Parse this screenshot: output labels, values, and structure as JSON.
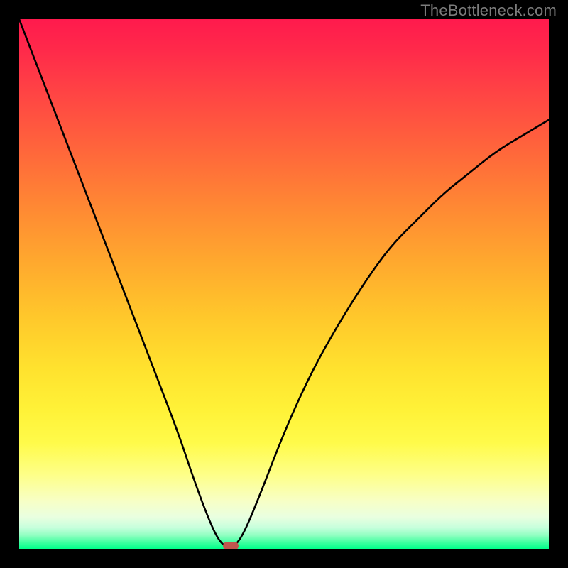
{
  "watermark": "TheBottleneck.com",
  "chart_data": {
    "type": "line",
    "title": "",
    "xlabel": "",
    "ylabel": "",
    "xlim": [
      0,
      100
    ],
    "ylim": [
      0,
      100
    ],
    "grid": false,
    "legend": false,
    "gradient_stops": [
      {
        "pos": 0,
        "color": "#ff1a4d"
      },
      {
        "pos": 14,
        "color": "#ff4444"
      },
      {
        "pos": 36,
        "color": "#ff8a33"
      },
      {
        "pos": 56,
        "color": "#ffc72b"
      },
      {
        "pos": 74,
        "color": "#fff238"
      },
      {
        "pos": 91,
        "color": "#e9ffe0"
      },
      {
        "pos": 100,
        "color": "#00ff8a"
      }
    ],
    "series": [
      {
        "name": "bottleneck-curve",
        "x": [
          0,
          5,
          10,
          15,
          20,
          25,
          30,
          33,
          36,
          38,
          40,
          42,
          45,
          50,
          55,
          60,
          65,
          70,
          75,
          80,
          85,
          90,
          95,
          100
        ],
        "y": [
          100,
          87,
          74,
          61,
          48,
          35,
          22,
          13,
          5,
          1,
          0,
          2,
          9,
          22,
          33,
          42,
          50,
          57,
          62,
          67,
          71,
          75,
          78,
          81
        ]
      }
    ],
    "minimum_point": {
      "x": 40,
      "y": 0
    },
    "minimum_marker_color": "#c0564e"
  }
}
